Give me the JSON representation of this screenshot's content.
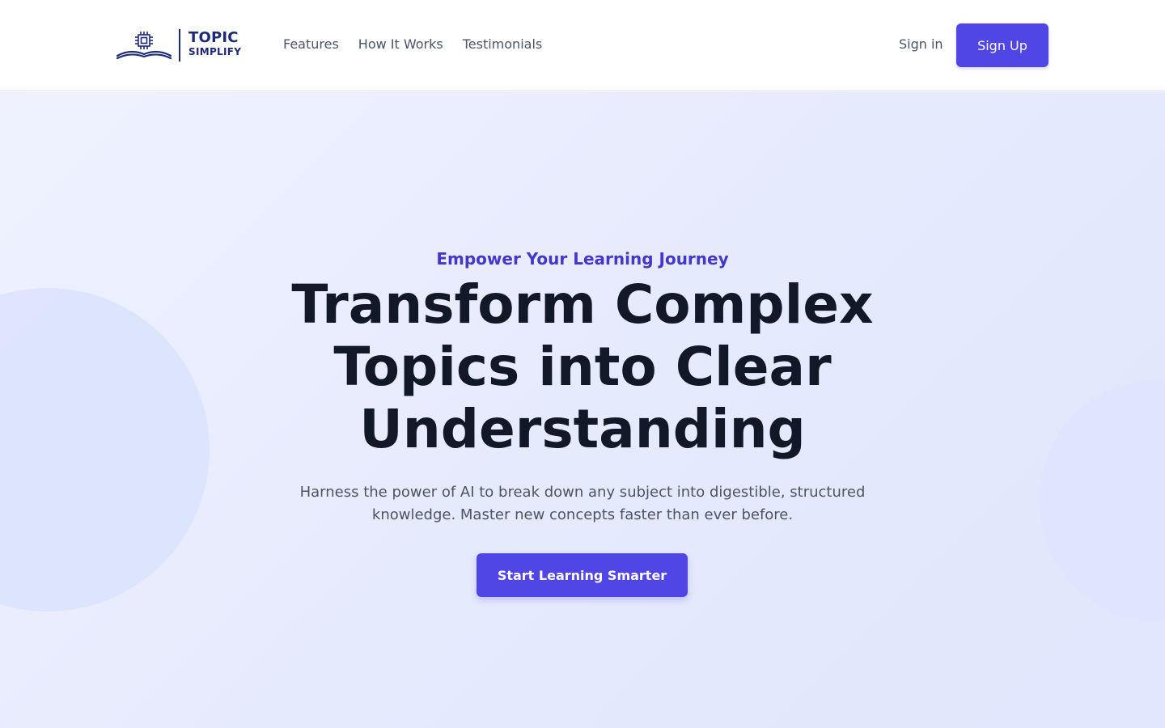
{
  "brand": {
    "line1": "TOPIC",
    "line2": "SIMPLIFY",
    "logo_icon": "open-book-chip-icon",
    "color": "#1e2a78"
  },
  "nav": {
    "items": [
      {
        "label": "Features"
      },
      {
        "label": "How It Works"
      },
      {
        "label": "Testimonials"
      }
    ]
  },
  "auth": {
    "signin_label": "Sign in",
    "signup_label": "Sign Up"
  },
  "hero": {
    "eyebrow": "Empower Your Learning Journey",
    "headline": "Transform Complex Topics into Clear Understanding",
    "subtext": "Harness the power of AI to break down any subject into digestible, structured knowledge. Master new concepts faster than ever before.",
    "cta_label": "Start Learning Smarter"
  },
  "colors": {
    "accent": "#4f46e5",
    "eyebrow": "#4338ca",
    "heading": "#111827",
    "body": "#4b5563"
  }
}
